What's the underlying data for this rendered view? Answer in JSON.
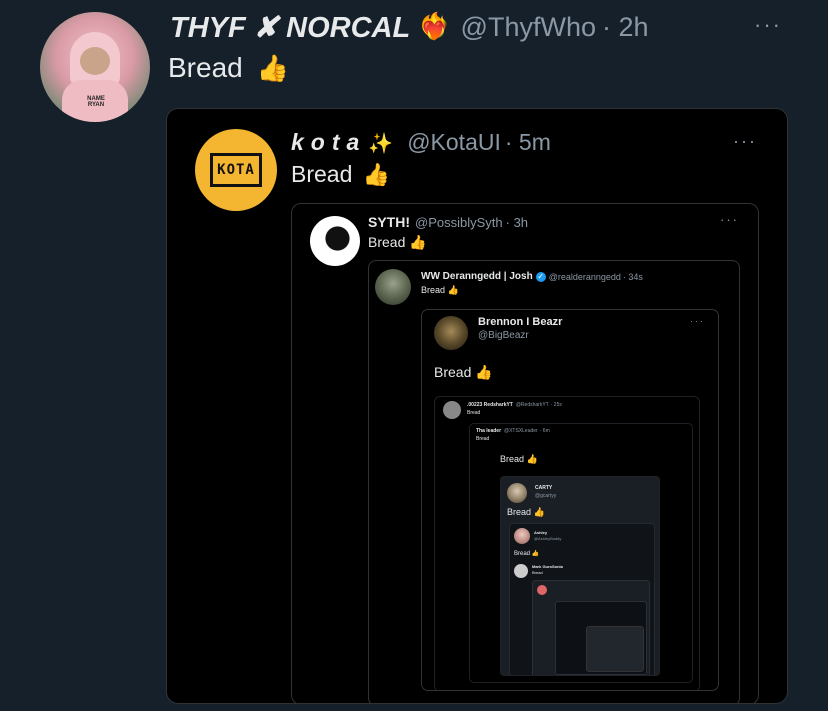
{
  "main": {
    "name": "THYF ✘ NORCAL",
    "heart": "❤️‍🔥",
    "handle": "@ThyfWho",
    "time": "· 2h",
    "text": "Bread",
    "thumb": "👍",
    "more": "···",
    "avatar_text": "NAME RYAN"
  },
  "q1": {
    "name": "kota",
    "sparkle": "✨",
    "handle": "@KotaUI",
    "time": "· 5m",
    "text": "Bread",
    "more": "···",
    "logo": "KOTA"
  },
  "q2": {
    "name": "SYTH!",
    "handle": "@PossiblySyth",
    "time": "· 3h",
    "text": "Bread",
    "more": "···"
  },
  "q3": {
    "name": "WW Deranngedd | Josh",
    "handle": "@realderanngedd",
    "time": "· 34s",
    "text": "Bread"
  },
  "q4": {
    "name": "Brennon I Beazr",
    "handle": "@BigBeazr",
    "text": "Bread",
    "more": "···"
  },
  "q5": {
    "name": ".00223 RedsharkYT",
    "handle": "@RedsharkYT",
    "time": "· 25s",
    "text": "Bread"
  },
  "q6": {
    "name": "Tha leader",
    "handle": "@XTSXLeader",
    "time": "· 6m",
    "text": "Bread"
  },
  "q7": {
    "text": "Bread"
  },
  "q8": {
    "name": "CARTY",
    "handle": "@gcartyy",
    "text": "Bread"
  },
  "q9": {
    "name": "Ashley",
    "handle": "@AshleyBuddy",
    "text": "Bread"
  },
  "q10": {
    "name": "Mark GuroSonia",
    "text": "Bread"
  },
  "colors": {
    "background": "#15202b",
    "card": "#000000",
    "accent": "#1d9bf0",
    "muted": "#8b98a5",
    "logo": "#f4b631"
  }
}
